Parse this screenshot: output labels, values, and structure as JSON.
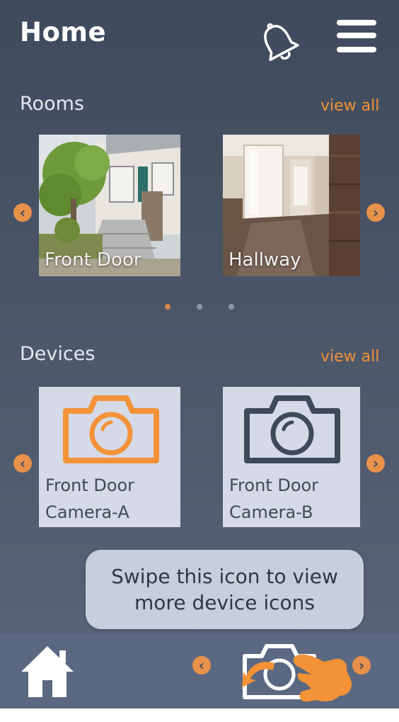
{
  "header": {
    "title": "Home",
    "icons": [
      "bell-icon",
      "menu-icon"
    ]
  },
  "rooms": {
    "title": "Rooms",
    "view_all": "view all",
    "items": [
      {
        "label": "Front Door"
      },
      {
        "label": "Hallway"
      }
    ],
    "pagination": {
      "count": 3,
      "active": 0
    }
  },
  "devices": {
    "title": "Devices",
    "view_all": "view all",
    "items": [
      {
        "label_line1": "Front Door",
        "label_line2": "Camera-A",
        "icon": "camera-icon",
        "color": "#f39237"
      },
      {
        "label_line1": "Front Door",
        "label_line2": "Camera-B",
        "icon": "camera-icon",
        "color": "#3e4a5a"
      }
    ]
  },
  "tooltip": {
    "line1": "Swipe this icon to view",
    "line2": "more device icons"
  },
  "bottom_nav": {
    "icons": [
      "home-icon",
      "camera-icon",
      "swipe-hand-icon"
    ]
  },
  "colors": {
    "accent": "#f39237",
    "background": "#4b5669",
    "card": "#d5dae6",
    "tooltip": "#c7cfdd"
  }
}
